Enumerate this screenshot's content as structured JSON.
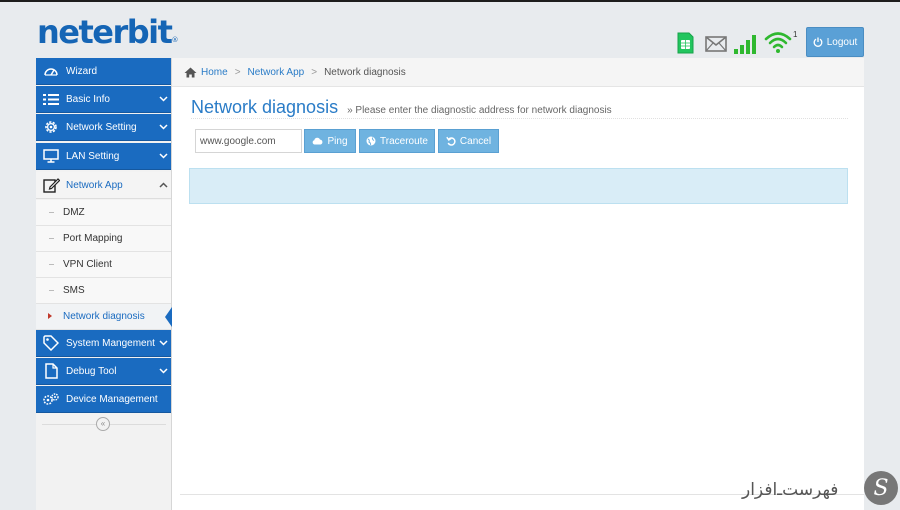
{
  "brand": {
    "logo_text": "neterbit",
    "logo_mark": "®"
  },
  "header": {
    "status_icons": [
      "sim-card-icon",
      "mail-icon",
      "signal-bars-icon",
      "wifi-icon"
    ],
    "wifi_client_count": "1",
    "logout_label": "Logout"
  },
  "sidebar": {
    "items": [
      {
        "label": "Wizard",
        "icon": "speedometer-icon",
        "expandable": false
      },
      {
        "label": "Basic Info",
        "icon": "list-icon",
        "expandable": true
      },
      {
        "label": "Network Setting",
        "icon": "gear-icon",
        "expandable": true
      },
      {
        "label": "LAN Setting",
        "icon": "monitor-icon",
        "expandable": true
      },
      {
        "label": "Network App",
        "icon": "edit-icon",
        "expandable": true,
        "open": true
      },
      {
        "label": "System Mangement",
        "icon": "tag-icon",
        "expandable": true
      },
      {
        "label": "Debug Tool",
        "icon": "file-icon",
        "expandable": true
      },
      {
        "label": "Device Management",
        "icon": "gears-icon",
        "expandable": false
      }
    ],
    "network_app_children": [
      {
        "label": "DMZ"
      },
      {
        "label": "Port Mapping"
      },
      {
        "label": "VPN Client"
      },
      {
        "label": "SMS"
      },
      {
        "label": "Network diagnosis",
        "active": true
      }
    ],
    "collapse_symbol": "«"
  },
  "breadcrumb": {
    "home": "Home",
    "section": "Network App",
    "current": "Network diagnosis",
    "separator": ">"
  },
  "page": {
    "title": "Network diagnosis",
    "subtitle": "» Please enter the diagnostic address for network diagnosis",
    "address_value": "www.google.com",
    "buttons": {
      "ping": "Ping",
      "traceroute": "Traceroute",
      "cancel": "Cancel"
    },
    "result_text": ""
  },
  "watermark": {
    "text": "فهرست‌ـ‌افزار"
  },
  "colors": {
    "brand_blue": "#1565b5",
    "nav_blue": "#1a6bc0",
    "button_blue": "#6fb3e0",
    "result_bg": "#d9edf7",
    "link_blue": "#2a7cc7"
  }
}
